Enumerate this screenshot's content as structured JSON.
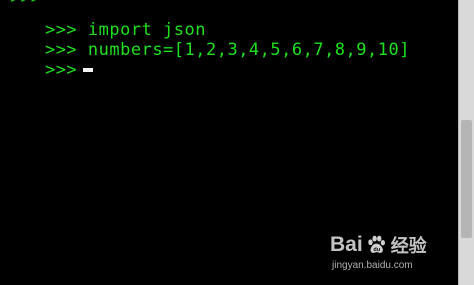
{
  "console": {
    "lines": [
      {
        "prompt": ">>>",
        "code": " import json"
      },
      {
        "prompt": ">>>",
        "code": " numbers=[1,2,3,4,5,6,7,8,9,10]"
      },
      {
        "prompt": ">>>",
        "code": ""
      }
    ]
  },
  "watermark": {
    "brand_left": "Bai",
    "brand_right": "du",
    "product": "经验",
    "url": "jingyan.baidu.com"
  },
  "colors": {
    "text": "#1ee01e",
    "background": "#000000",
    "cursor": "#f2f2f2"
  }
}
